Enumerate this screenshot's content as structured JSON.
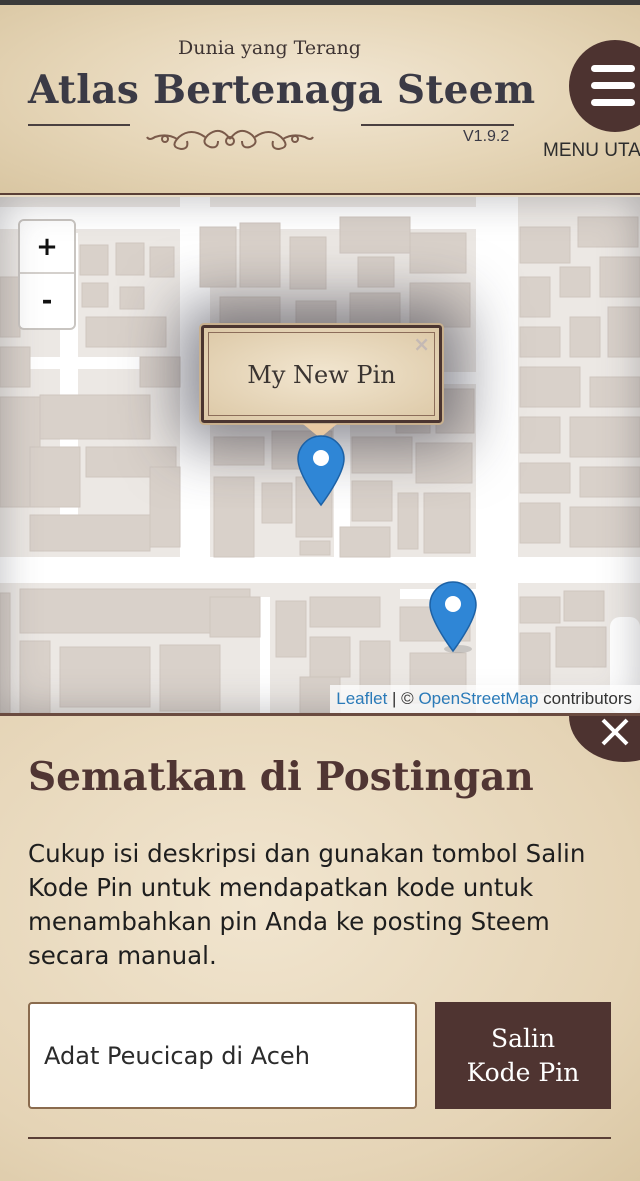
{
  "header": {
    "subtitle": "Dunia yang Terang",
    "title": "Atlas Bertenaga Steem",
    "version": "V1.9.2",
    "menu_label": "MENU UTA",
    "menu_icon": "hamburger-icon"
  },
  "map": {
    "zoom_in_label": "+",
    "zoom_out_label": "-",
    "popup": {
      "text": "My New Pin",
      "close_label": "×"
    },
    "attribution": {
      "leaflet": "Leaflet",
      "separator": " | © ",
      "osm": "OpenStreetMap",
      "suffix": " contributors"
    },
    "marker_color": "#2f86d6"
  },
  "panel": {
    "title": "Sematkan di Postingan",
    "description": "Cukup isi deskripsi dan gunakan tombol Salin Kode Pin untuk mendapatkan kode untuk menambahkan pin Anda ke posting Steem secara manual.",
    "input_value": "Adat Peucicap di Aceh",
    "copy_button_line1": "Salin",
    "copy_button_line2": "Kode Pin",
    "close_icon": "close-icon"
  },
  "colors": {
    "accent": "#4d3330",
    "parchment": "#e9dcc4",
    "link": "#2a7ab8"
  }
}
